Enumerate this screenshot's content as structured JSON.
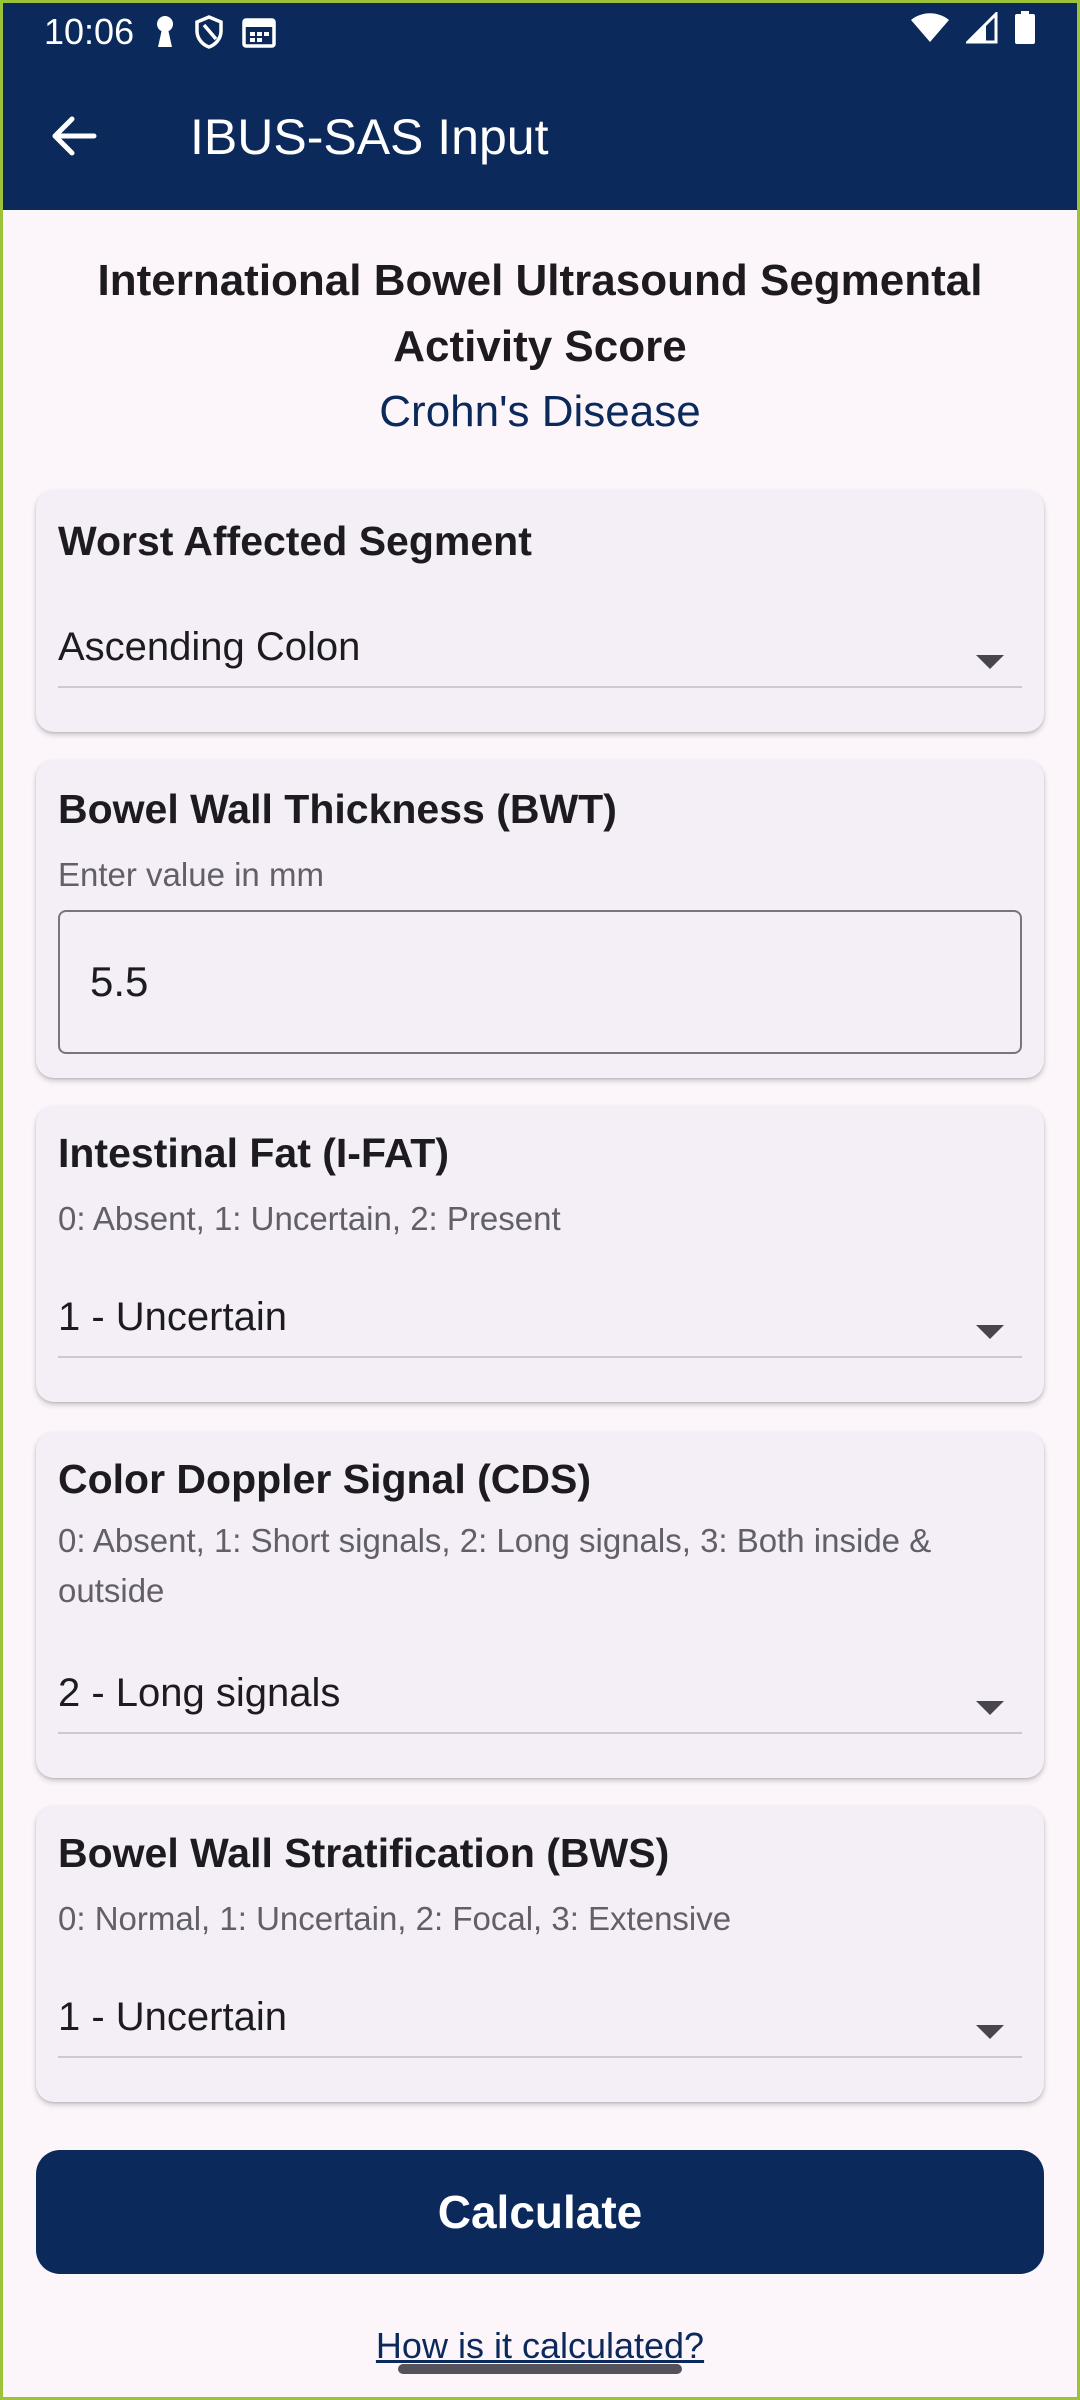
{
  "status_bar": {
    "time": "10:06",
    "left_icons": [
      "keyhole-icon",
      "shield-icon",
      "calendar-icon"
    ],
    "right_icons": [
      "wifi-icon",
      "signal-icon",
      "battery-icon"
    ]
  },
  "app_bar": {
    "title": "IBUS-SAS Input",
    "back_icon": "arrow-left-icon",
    "color": "#0b2a5b"
  },
  "header": {
    "title": "International Bowel Ultrasound Segmental Activity Score",
    "subtitle": "Crohn's Disease"
  },
  "fields": {
    "segment": {
      "label": "Worst Affected Segment",
      "value": "Ascending Colon"
    },
    "bwt": {
      "label": "Bowel Wall Thickness (BWT)",
      "hint": "Enter value in mm",
      "value": "5.5"
    },
    "ifat": {
      "label": "Intestinal Fat (I-FAT)",
      "hint": "0: Absent, 1: Uncertain, 2: Present",
      "value": "1 - Uncertain"
    },
    "cds": {
      "label": "Color Doppler Signal (CDS)",
      "hint": "0: Absent, 1: Short signals, 2: Long signals, 3: Both inside & outside",
      "value": "2 - Long signals"
    },
    "bws": {
      "label": "Bowel Wall Stratification (BWS)",
      "hint": "0: Normal, 1: Uncertain, 2: Focal, 3: Extensive",
      "value": "1 - Uncertain"
    }
  },
  "actions": {
    "calculate_label": "Calculate",
    "help_link": "How is it calculated?"
  }
}
